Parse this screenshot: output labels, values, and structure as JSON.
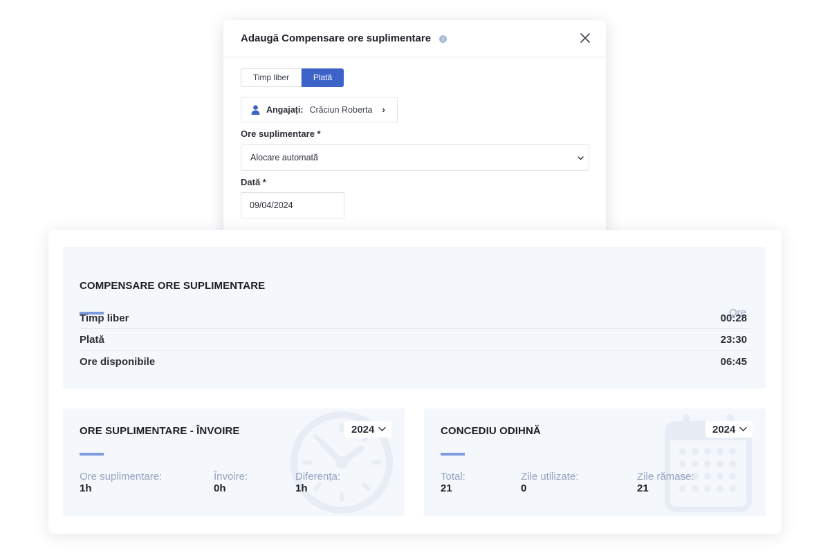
{
  "modal": {
    "title": "Adaugă Compensare ore suplimentare",
    "info_icon": "info-icon",
    "close_icon": "close-icon",
    "tabs": [
      {
        "label": "Timp liber",
        "active": false
      },
      {
        "label": "Plată",
        "active": true
      }
    ],
    "employee": {
      "label": "Angajați:",
      "value": "Crăciun Roberta",
      "icon": "user-icon"
    },
    "overtime_field": {
      "label": "Ore suplimentare *",
      "value": "Alocare automată"
    },
    "date_field": {
      "label": "Dată *",
      "value": "09/04/2024"
    }
  },
  "compensation": {
    "title": "COMPENSARE ORE SUPLIMENTARE",
    "column_header": "Ore",
    "rows": [
      {
        "label": "Timp liber",
        "value": "00:28"
      },
      {
        "label": "Plată",
        "value": "23:30"
      },
      {
        "label": "Ore disponibile",
        "value": "06:45"
      }
    ]
  },
  "overtime_leave": {
    "title": "ORE SUPLIMENTARE - ÎNVOIRE",
    "year": "2024",
    "stats": [
      {
        "label": "Ore suplimentare:",
        "value": "1h"
      },
      {
        "label": "Învoire:",
        "value": "0h"
      },
      {
        "label": "Diferența:",
        "value": "1h"
      }
    ],
    "illustration": "clock-icon"
  },
  "vacation": {
    "title": "CONCEDIU ODIHNĂ",
    "year": "2024",
    "stats": [
      {
        "label": "Total:",
        "value": "21"
      },
      {
        "label": "Zile utilizate:",
        "value": "0"
      },
      {
        "label": "Zile rămase:",
        "value": "21"
      }
    ],
    "illustration": "calendar-icon"
  },
  "colors": {
    "primary": "#3d63c9",
    "accent_bar": "#7e9ae0",
    "panel_bg": "#f4f7fb",
    "muted_text": "#95a3bf"
  }
}
